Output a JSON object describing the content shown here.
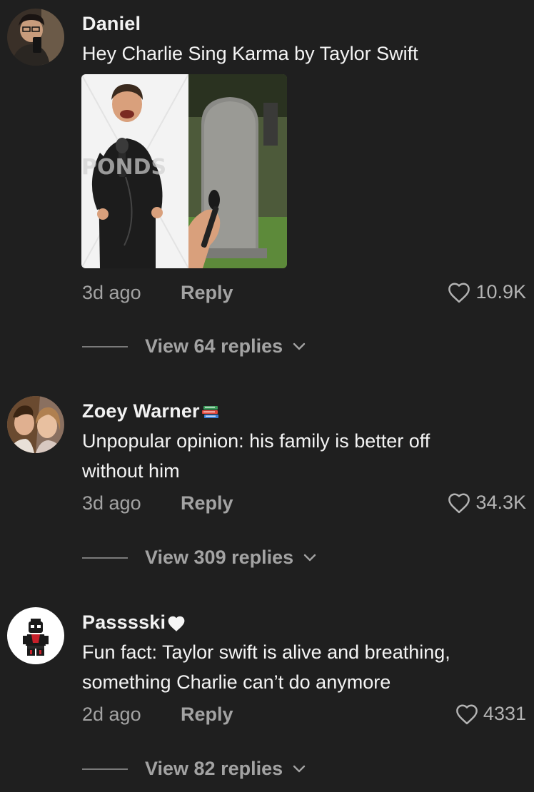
{
  "comments": [
    {
      "username": "Daniel",
      "text": "Hey Charlie Sing Karma by Taylor Swift",
      "time": "3d ago",
      "reply_label": "Reply",
      "likes": "10.9K",
      "view_replies": "View 64 replies",
      "image_watermark": "PONDS",
      "avatar_icon": "person-selfie-avatar"
    },
    {
      "username": "Zoey Warner",
      "badge_icon": "books-emoji",
      "text": "Unpopular opinion: his family is better off without him",
      "time": "3d ago",
      "reply_label": "Reply",
      "likes": "34.3K",
      "view_replies": "View 309 replies",
      "avatar_icon": "two-people-avatar"
    },
    {
      "username": "Passsski",
      "badge_icon": "white-heart-emoji",
      "text": "Fun fact: Taylor swift is alive and breathing, something Charlie can’t do anymore",
      "time": "2d ago",
      "reply_label": "Reply",
      "likes": "4331",
      "view_replies": "View 82 replies",
      "avatar_icon": "lego-spiderman-avatar"
    }
  ],
  "colors": {
    "background": "#1f1f1f",
    "text_primary": "#f4f4f4",
    "text_secondary": "#a3a3a3"
  }
}
